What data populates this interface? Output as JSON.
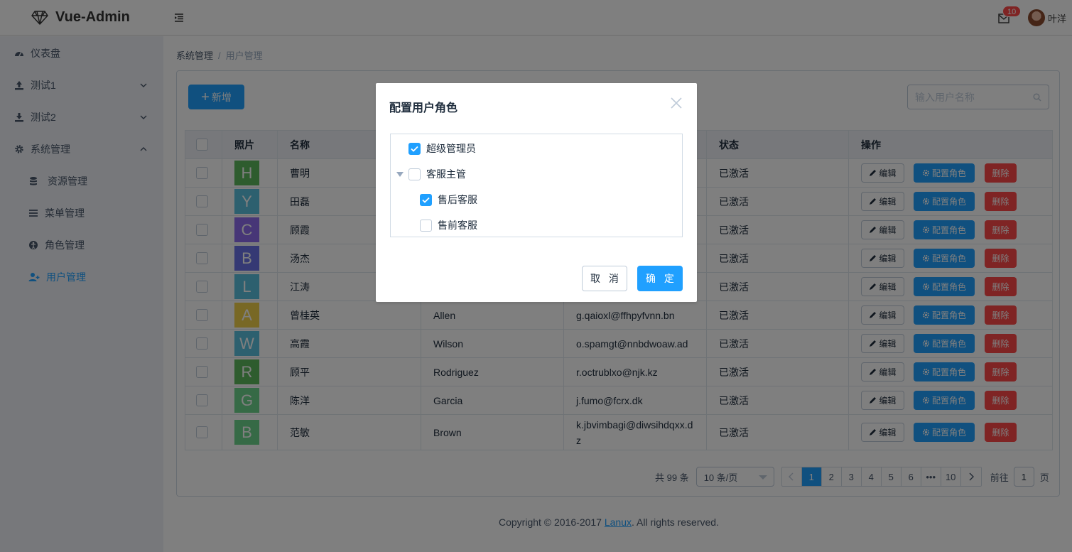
{
  "app": {
    "title": "Vue-Admin"
  },
  "header": {
    "mail_count": "10",
    "user_name": "叶洋"
  },
  "sidebar": {
    "items": [
      {
        "label": "仪表盘",
        "icon": "dashboard-icon"
      },
      {
        "label": "测试1",
        "icon": "upload-icon"
      },
      {
        "label": "测试2",
        "icon": "download-icon"
      },
      {
        "label": "系统管理",
        "icon": "gear-icon"
      },
      {
        "label": "资源管理",
        "icon": "database-icon"
      },
      {
        "label": "菜单管理",
        "icon": "list-icon"
      },
      {
        "label": "角色管理",
        "icon": "role-icon"
      },
      {
        "label": "用户管理",
        "icon": "user-add-icon",
        "active": true
      }
    ]
  },
  "breadcrumb": {
    "parent": "系统管理",
    "separator": "/",
    "current": "用户管理"
  },
  "toolbar": {
    "add_label": "新增",
    "search_placeholder": "输入用户名称"
  },
  "table": {
    "columns": [
      "照片",
      "名称",
      "",
      "",
      "状态",
      "操作"
    ],
    "rows": [
      {
        "letter": "H",
        "color": "#5cb85c",
        "name": "曹明",
        "en": "",
        "email": "",
        "status": "已激活"
      },
      {
        "letter": "Y",
        "color": "#5bc0de",
        "name": "田磊",
        "en": "",
        "email": "",
        "status": "已激活"
      },
      {
        "letter": "C",
        "color": "#8e6cef",
        "name": "顾霞",
        "en": "",
        "email": "",
        "status": "已激活"
      },
      {
        "letter": "B",
        "color": "#6a72e8",
        "name": "汤杰",
        "en": "",
        "email": "",
        "status": "已激活"
      },
      {
        "letter": "L",
        "color": "#5bc0de",
        "name": "江涛",
        "en": "",
        "email": "",
        "status": "已激活"
      },
      {
        "letter": "A",
        "color": "#f0d04a",
        "name": "曾桂英",
        "en": "Allen",
        "email": "g.qaioxl@ffhpyfvnn.bn",
        "status": "已激活"
      },
      {
        "letter": "W",
        "color": "#5bc0de",
        "name": "高霞",
        "en": "Wilson",
        "email": "o.spamgt@nnbdwoaw.ad",
        "status": "已激活"
      },
      {
        "letter": "R",
        "color": "#5cb85c",
        "name": "顾平",
        "en": "Rodriguez",
        "email": "r.octrublxo@njk.kz",
        "status": "已激活"
      },
      {
        "letter": "G",
        "color": "#6cd48c",
        "name": "陈洋",
        "en": "Garcia",
        "email": "j.fumo@fcrx.dk",
        "status": "已激活"
      },
      {
        "letter": "B",
        "color": "#6cd48c",
        "name": "范敏",
        "en": "Brown",
        "email": "k.jbvimbagi@diwsihdqxx.dz",
        "status": "已激活"
      }
    ],
    "actions": {
      "edit": "编辑",
      "role": "配置角色",
      "delete": "删除"
    }
  },
  "pagination": {
    "total": "共 99 条",
    "page_size": "10 条/页",
    "pages": [
      "1",
      "2",
      "3",
      "4",
      "5",
      "6",
      "•••",
      "10"
    ],
    "current": "1",
    "goto_prefix": "前往",
    "goto_value": "1",
    "goto_suffix": "页"
  },
  "footer": {
    "prefix": "Copyright © 2016-2017 ",
    "link": "Lanux",
    "suffix": ". All rights reserved."
  },
  "dialog": {
    "title": "配置用户角色",
    "tree": [
      {
        "label": "超级管理员",
        "checked": true
      },
      {
        "label": "客服主管",
        "checked": false
      },
      {
        "label": "售后客服",
        "checked": true
      },
      {
        "label": "售前客服",
        "checked": false
      }
    ],
    "cancel": "取 消",
    "confirm": "确 定"
  },
  "colors": {
    "primary": "#20a0ff",
    "danger": "#ff4949",
    "sidebar_bg": "#eef1f6"
  }
}
